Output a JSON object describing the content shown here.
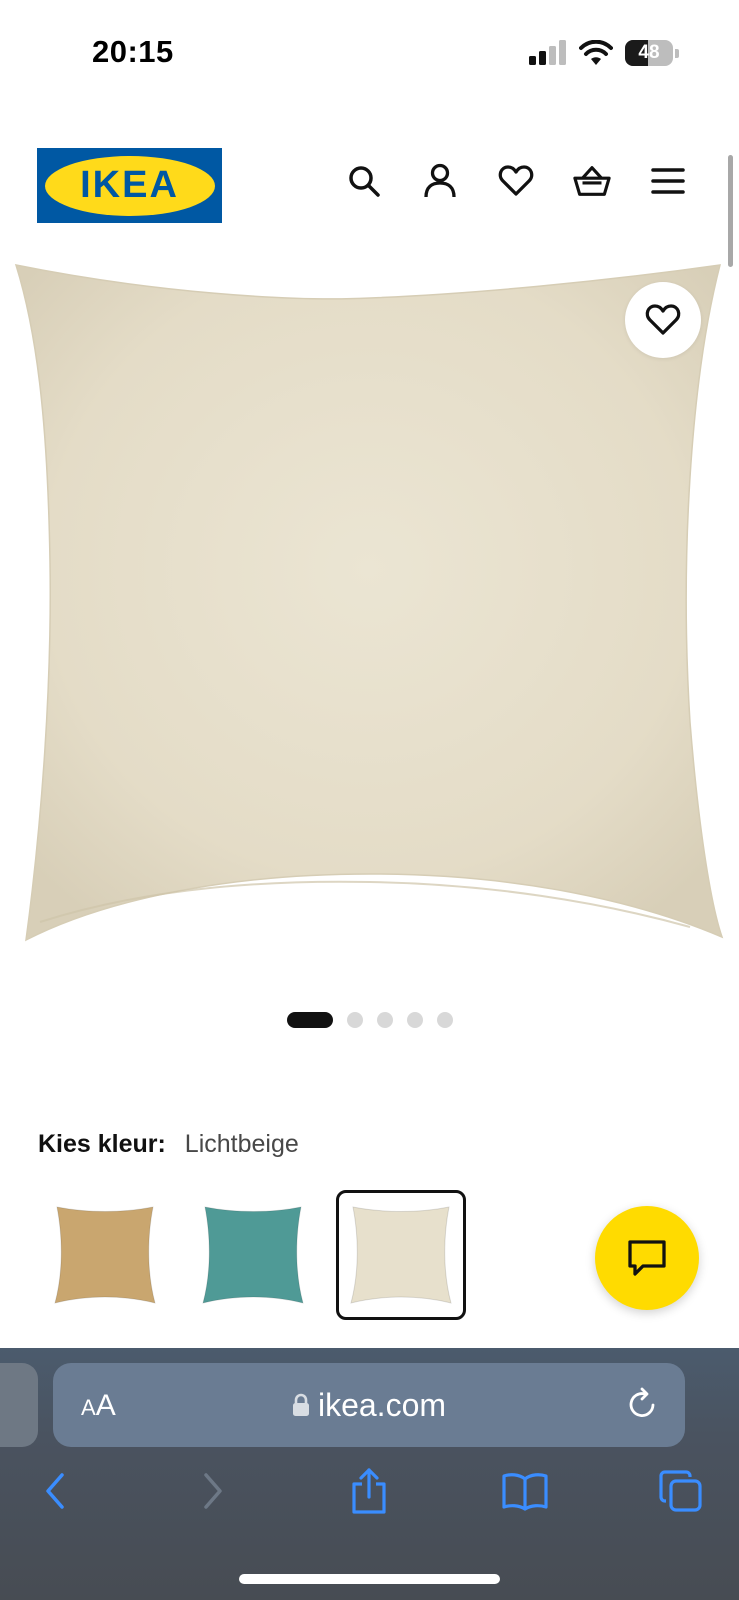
{
  "status_bar": {
    "time": "20:15",
    "battery": "48",
    "battery_level": 0.48
  },
  "header": {
    "logo_text": "IKEA",
    "icons": [
      "search-icon",
      "account-icon",
      "heart-icon",
      "basket-icon",
      "menu-icon"
    ],
    "brand_colors": {
      "blue": "#0058a3",
      "yellow": "#ffda1a"
    }
  },
  "product": {
    "image_color": "#e7e0cc",
    "carousel": {
      "total": 5,
      "active": 1
    }
  },
  "color_choice": {
    "label": "Kies kleur:",
    "value": "Lichtbeige",
    "swatches": [
      {
        "name": "goudbruin",
        "color": "#c9a66f",
        "selected": false
      },
      {
        "name": "turkoois",
        "color": "#4f9a96",
        "selected": false
      },
      {
        "name": "lichtbeige",
        "color": "#e7e0cc",
        "selected": true
      }
    ]
  },
  "chat": {
    "color": "#ffdb00",
    "icon": "chat-icon"
  },
  "safari": {
    "aa_small": "A",
    "aa_big": "A",
    "url": "ikea.com",
    "toolbar_icons": [
      "back-icon",
      "forward-icon",
      "share-icon",
      "bookmarks-icon",
      "tabs-icon"
    ]
  }
}
